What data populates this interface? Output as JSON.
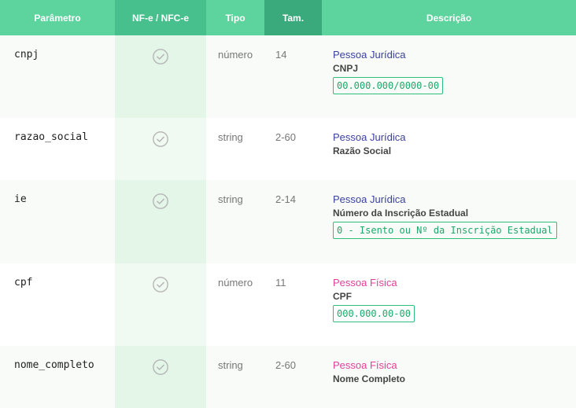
{
  "headers": {
    "parametro": "Parâmetro",
    "nfe": "NF-e / NFC-e",
    "tipo": "Tipo",
    "tam": "Tam.",
    "descricao": "Descrição"
  },
  "rows": [
    {
      "param": "cnpj",
      "tipo": "número",
      "tam": "14",
      "categoria": "Pessoa Jurídica",
      "titulo": "CNPJ",
      "formato": "00.000.000/0000-00"
    },
    {
      "param": "razao_social",
      "tipo": "string",
      "tam": "2-60",
      "categoria": "Pessoa Jurídica",
      "titulo": "Razão Social",
      "formato": ""
    },
    {
      "param": "ie",
      "tipo": "string",
      "tam": "2-14",
      "categoria": "Pessoa Jurídica",
      "titulo": "Número da Inscrição Estadual",
      "formato": "0 - Isento ou Nº da Inscrição Estadual"
    },
    {
      "param": "cpf",
      "tipo": "número",
      "tam": "11",
      "categoria": "Pessoa Física",
      "titulo": "CPF",
      "formato": "000.000.00-00"
    },
    {
      "param": "nome_completo",
      "tipo": "string",
      "tam": "2-60",
      "categoria": "Pessoa Física",
      "titulo": "Nome Completo",
      "formato": ""
    }
  ],
  "colors": {
    "header": "#5dd39e",
    "pessoa_juridica": "#3b3f9e",
    "pessoa_fisica": "#e0409a",
    "format_border": "#2fbf7a"
  },
  "icons": {
    "nfe_supported": "check-circle-icon"
  }
}
